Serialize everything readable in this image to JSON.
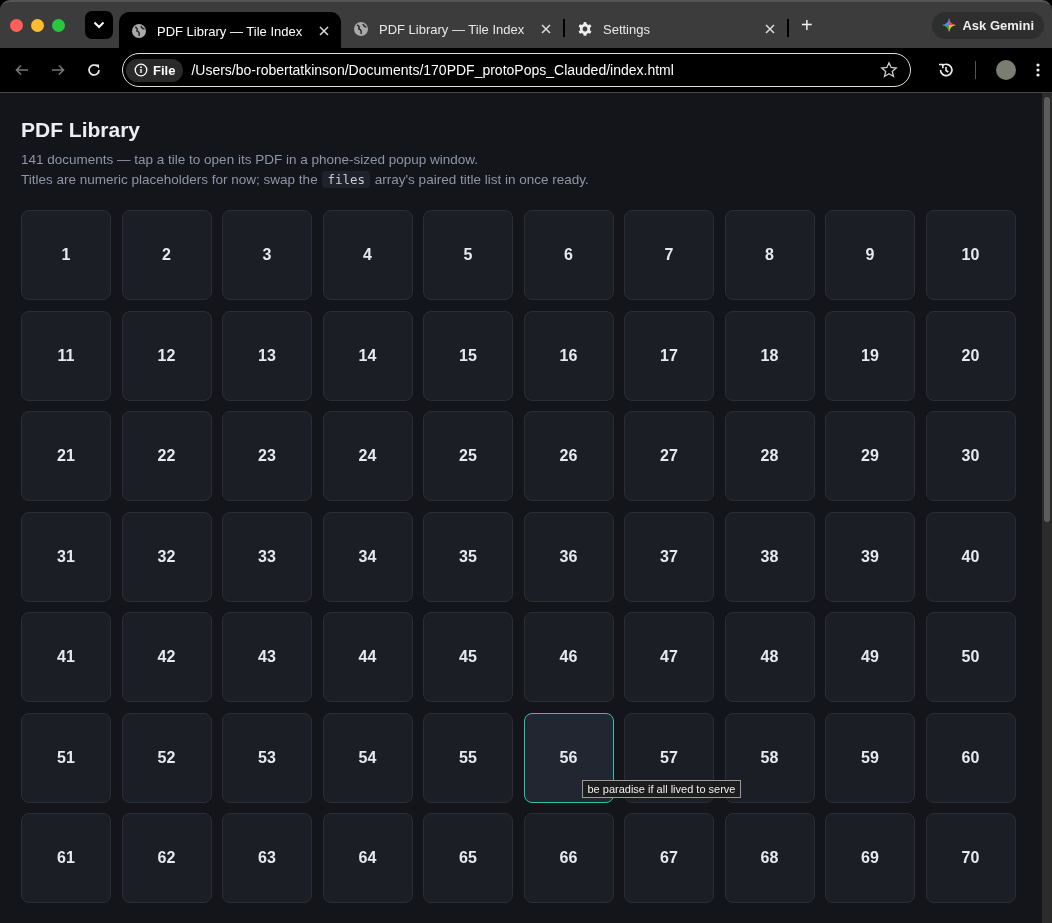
{
  "browser": {
    "tabs": [
      {
        "title": "PDF Library — Tile Index",
        "kind": "page",
        "selected": true
      },
      {
        "title": "PDF Library — Tile Index",
        "kind": "page",
        "selected": false
      },
      {
        "title": "Settings",
        "kind": "settings",
        "selected": false
      }
    ],
    "new_tab": "+",
    "ask_button": "Ask Gemini",
    "address": {
      "badge": "File",
      "url": "/Users/bo-robertatkinson/Documents/170PDF_protoPops_Clauded/index.html"
    }
  },
  "page": {
    "title": "PDF Library",
    "subtitle": "141 documents — tap a tile to open its PDF in a phone-sized popup window.",
    "note": {
      "before": "Titles are numeric placeholders for now; swap the",
      "code": "files",
      "after": "array's paired title list in once ready."
    },
    "tiles": [
      {
        "label": "1",
        "hovered": false
      },
      {
        "label": "2",
        "hovered": false
      },
      {
        "label": "3",
        "hovered": false
      },
      {
        "label": "4",
        "hovered": false
      },
      {
        "label": "5",
        "hovered": false
      },
      {
        "label": "6",
        "hovered": false
      },
      {
        "label": "7",
        "hovered": false
      },
      {
        "label": "8",
        "hovered": false
      },
      {
        "label": "9",
        "hovered": false
      },
      {
        "label": "10",
        "hovered": false
      },
      {
        "label": "11",
        "hovered": false
      },
      {
        "label": "12",
        "hovered": false
      },
      {
        "label": "13",
        "hovered": false
      },
      {
        "label": "14",
        "hovered": false
      },
      {
        "label": "15",
        "hovered": false
      },
      {
        "label": "16",
        "hovered": false
      },
      {
        "label": "17",
        "hovered": false
      },
      {
        "label": "18",
        "hovered": false
      },
      {
        "label": "19",
        "hovered": false
      },
      {
        "label": "20",
        "hovered": false
      },
      {
        "label": "21",
        "hovered": false
      },
      {
        "label": "22",
        "hovered": false
      },
      {
        "label": "23",
        "hovered": false
      },
      {
        "label": "24",
        "hovered": false
      },
      {
        "label": "25",
        "hovered": false
      },
      {
        "label": "26",
        "hovered": false
      },
      {
        "label": "27",
        "hovered": false
      },
      {
        "label": "28",
        "hovered": false
      },
      {
        "label": "29",
        "hovered": false
      },
      {
        "label": "30",
        "hovered": false
      },
      {
        "label": "31",
        "hovered": false
      },
      {
        "label": "32",
        "hovered": false
      },
      {
        "label": "33",
        "hovered": false
      },
      {
        "label": "34",
        "hovered": false
      },
      {
        "label": "35",
        "hovered": false
      },
      {
        "label": "36",
        "hovered": false
      },
      {
        "label": "37",
        "hovered": false
      },
      {
        "label": "38",
        "hovered": false
      },
      {
        "label": "39",
        "hovered": false
      },
      {
        "label": "40",
        "hovered": false
      },
      {
        "label": "41",
        "hovered": false
      },
      {
        "label": "42",
        "hovered": false
      },
      {
        "label": "43",
        "hovered": false
      },
      {
        "label": "44",
        "hovered": false
      },
      {
        "label": "45",
        "hovered": false
      },
      {
        "label": "46",
        "hovered": false
      },
      {
        "label": "47",
        "hovered": false
      },
      {
        "label": "48",
        "hovered": false
      },
      {
        "label": "49",
        "hovered": false
      },
      {
        "label": "50",
        "hovered": false
      },
      {
        "label": "51",
        "hovered": false
      },
      {
        "label": "52",
        "hovered": false
      },
      {
        "label": "53",
        "hovered": false
      },
      {
        "label": "54",
        "hovered": false
      },
      {
        "label": "55",
        "hovered": false
      },
      {
        "label": "56",
        "hovered": true,
        "tooltip": "be paradise if all lived to serve"
      },
      {
        "label": "57",
        "hovered": false
      },
      {
        "label": "58",
        "hovered": false
      },
      {
        "label": "59",
        "hovered": false
      },
      {
        "label": "60",
        "hovered": false
      },
      {
        "label": "61",
        "hovered": false
      },
      {
        "label": "62",
        "hovered": false
      },
      {
        "label": "63",
        "hovered": false
      },
      {
        "label": "64",
        "hovered": false
      },
      {
        "label": "65",
        "hovered": false
      },
      {
        "label": "66",
        "hovered": false
      },
      {
        "label": "67",
        "hovered": false
      },
      {
        "label": "68",
        "hovered": false
      },
      {
        "label": "69",
        "hovered": false
      },
      {
        "label": "70",
        "hovered": false
      }
    ]
  }
}
